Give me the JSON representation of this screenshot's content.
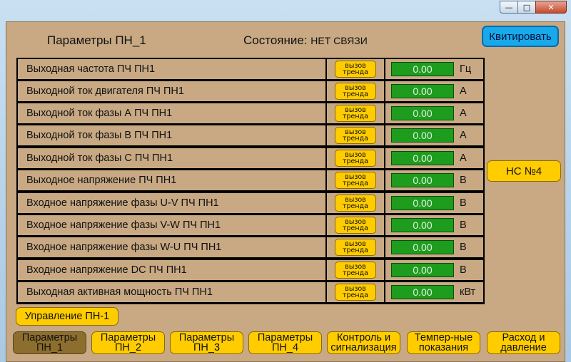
{
  "window": {
    "buttons": {
      "minimize": "—",
      "maximize": "□",
      "close": "✕"
    }
  },
  "header": {
    "title": "Параметры ПН_1",
    "status_label": "Состояние:",
    "status_value": "НЕТ СВЯЗИ",
    "ack_button": "Квитировать"
  },
  "parameters": [
    {
      "label": "Выходная частота ПЧ ПН1",
      "value": "0.00",
      "unit": "Гц"
    },
    {
      "label": "Выходной ток двигателя ПЧ ПН1",
      "value": "0.00",
      "unit": "А"
    },
    {
      "label": "Выходной ток фазы А ПЧ ПН1",
      "value": "0.00",
      "unit": "А"
    },
    {
      "label": "Выходной ток фазы В ПЧ ПН1",
      "value": "0.00",
      "unit": "А"
    },
    {
      "label": "Выходной ток фазы С ПЧ ПН1",
      "value": "0.00",
      "unit": "А"
    },
    {
      "label": "Выходное напряжение ПЧ ПН1",
      "value": "0.00",
      "unit": "В"
    },
    {
      "label": "Входное напряжение фазы U-V ПЧ ПН1",
      "value": "0.00",
      "unit": "В"
    },
    {
      "label": "Входное напряжение фазы V-W ПЧ ПН1",
      "value": "0.00",
      "unit": "В"
    },
    {
      "label": "Входное напряжение фазы W-U ПЧ ПН1",
      "value": "0.00",
      "unit": "В"
    },
    {
      "label": "Входное напряжение DC ПЧ ПН1",
      "value": "0.00",
      "unit": "В"
    },
    {
      "label": "Выходная активная мощность ПЧ ПН1",
      "value": "0.00",
      "unit": "кВт"
    }
  ],
  "trend_button": {
    "line1": "вызов",
    "line2": "тренда"
  },
  "side": {
    "ns_button": "НС №4"
  },
  "control_button": "Управление ПН-1",
  "nav": [
    {
      "line1": "Параметры",
      "line2": "ПН_1",
      "active": true
    },
    {
      "line1": "Параметры",
      "line2": "ПН_2",
      "active": false
    },
    {
      "line1": "Параметры",
      "line2": "ПН_3",
      "active": false
    },
    {
      "line1": "Параметры",
      "line2": "ПН_4",
      "active": false
    },
    {
      "line1": "Контроль и",
      "line2": "сигнализация",
      "active": false
    },
    {
      "line1": "Темпер-ные",
      "line2": "показания",
      "active": false
    },
    {
      "line1": "Расход и",
      "line2": "давление",
      "active": false
    }
  ],
  "colors": {
    "panel_bg": "#c8a983",
    "value_green": "#1e9c1e",
    "button_yellow": "#ffcc00",
    "button_active": "#8c6e2e",
    "ack_blue": "#17a9ea"
  }
}
